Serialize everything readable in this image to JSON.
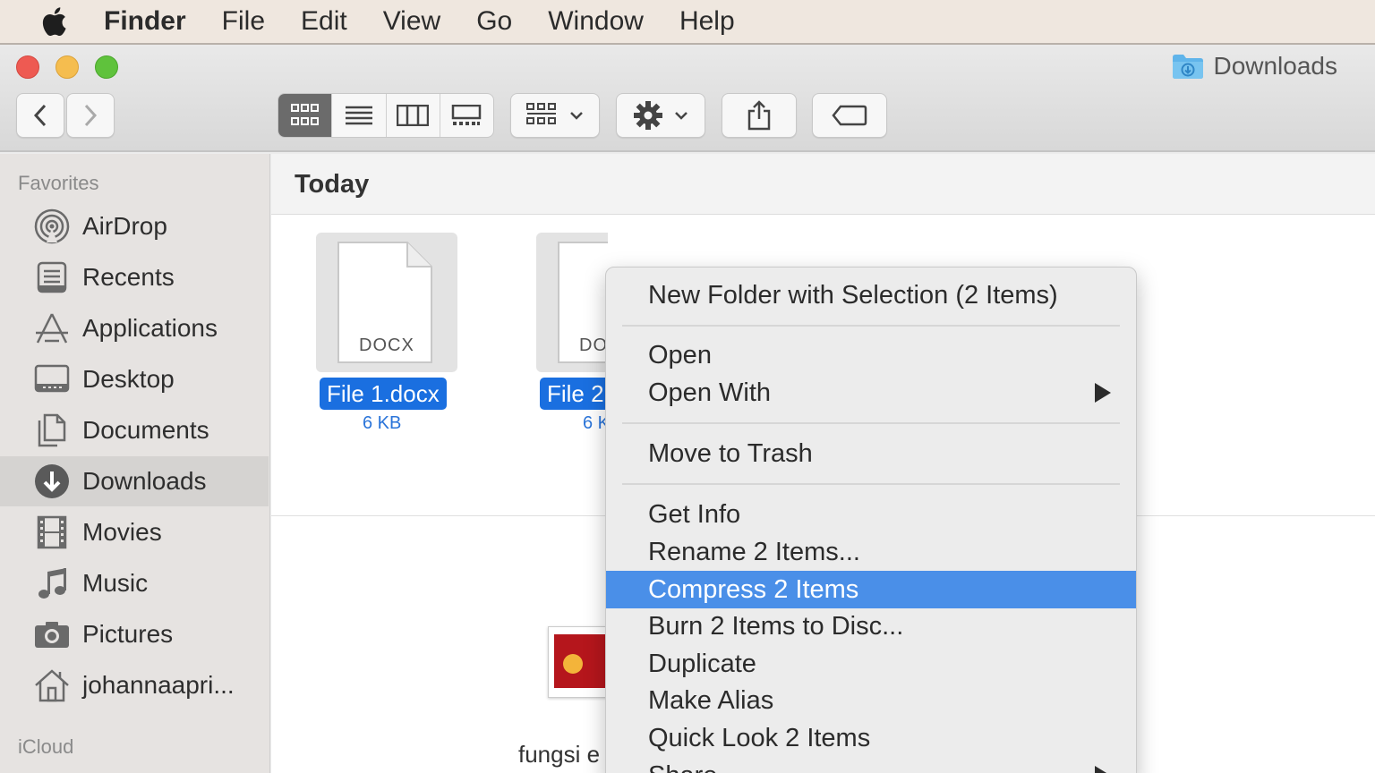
{
  "menubar": {
    "items": [
      "Finder",
      "File",
      "Edit",
      "View",
      "Go",
      "Window",
      "Help"
    ]
  },
  "window": {
    "title": "Downloads"
  },
  "sidebar": {
    "favorites_header": "Favorites",
    "items": [
      {
        "label": "AirDrop",
        "icon": "airdrop-icon"
      },
      {
        "label": "Recents",
        "icon": "recents-icon"
      },
      {
        "label": "Applications",
        "icon": "applications-icon"
      },
      {
        "label": "Desktop",
        "icon": "desktop-icon"
      },
      {
        "label": "Documents",
        "icon": "documents-icon"
      },
      {
        "label": "Downloads",
        "icon": "downloads-icon",
        "selected": true
      },
      {
        "label": "Movies",
        "icon": "movies-icon"
      },
      {
        "label": "Music",
        "icon": "music-icon"
      },
      {
        "label": "Pictures",
        "icon": "pictures-icon"
      },
      {
        "label": "johannaapri...",
        "icon": "home-icon"
      }
    ],
    "icloud_header": "iCloud"
  },
  "content": {
    "section_title": "Today",
    "files": [
      {
        "name": "File 1.docx",
        "size": "6 KB",
        "type_label": "DOCX"
      },
      {
        "name": "File 2",
        "size": "6 K",
        "type_label": "DO"
      }
    ],
    "partial_file_name": "fungsi e"
  },
  "context_menu": {
    "items": [
      "New Folder with Selection (2 Items)",
      "Open",
      "Open With",
      "Move to Trash",
      "Get Info",
      "Rename 2 Items...",
      "Compress 2 Items",
      "Burn 2 Items to Disc...",
      "Duplicate",
      "Make Alias",
      "Quick Look 2 Items",
      "Share"
    ],
    "highlighted": "Compress 2 Items"
  },
  "colors": {
    "selection_blue": "#1a6fe0",
    "menu_highlight": "#4a8fe8",
    "close": "#ee5a52",
    "minimize": "#f5bd4f",
    "zoom": "#5fc23c"
  }
}
